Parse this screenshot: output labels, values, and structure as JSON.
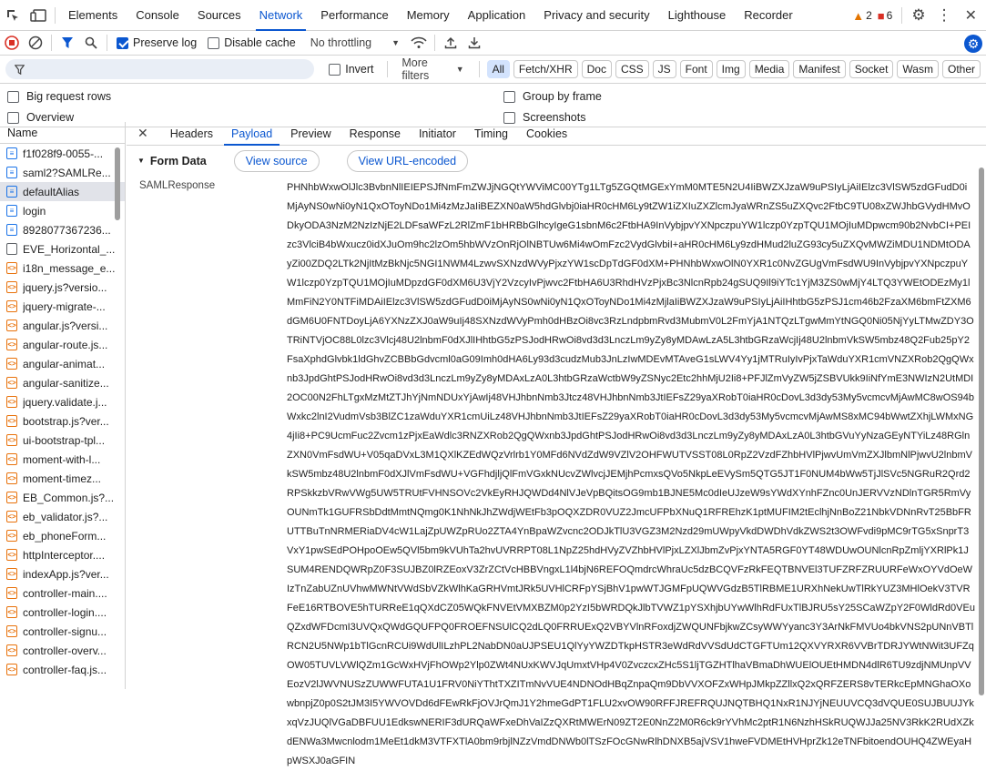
{
  "tabs": [
    "Elements",
    "Console",
    "Sources",
    "Network",
    "Performance",
    "Memory",
    "Application",
    "Privacy and security",
    "Lighthouse",
    "Recorder"
  ],
  "active_tab": "Network",
  "warnings_count": "2",
  "errors_count": "6",
  "toolbar": {
    "preserve_log": "Preserve log",
    "disable_cache": "Disable cache",
    "throttling": "No throttling"
  },
  "filter": {
    "invert": "Invert",
    "more_filters": "More filters",
    "chips": [
      "All",
      "Fetch/XHR",
      "Doc",
      "CSS",
      "JS",
      "Font",
      "Img",
      "Media",
      "Manifest",
      "Socket",
      "Wasm",
      "Other"
    ]
  },
  "options": {
    "big_request_rows": "Big request rows",
    "group_by_frame": "Group by frame",
    "overview": "Overview",
    "screenshots": "Screenshots"
  },
  "list_header": "Name",
  "requests": [
    {
      "name": "f1f028f9-0055-...",
      "type": "doc"
    },
    {
      "name": "saml2?SAMLRe...",
      "type": "doc"
    },
    {
      "name": "defaultAlias",
      "type": "doc",
      "selected": true
    },
    {
      "name": "login",
      "type": "doc"
    },
    {
      "name": "8928077367236...",
      "type": "doc"
    },
    {
      "name": "EVE_Horizontal_...",
      "type": "img"
    },
    {
      "name": "i18n_message_e...",
      "type": "js"
    },
    {
      "name": "jquery.js?versio...",
      "type": "js"
    },
    {
      "name": "jquery-migrate-...",
      "type": "js"
    },
    {
      "name": "angular.js?versi...",
      "type": "js"
    },
    {
      "name": "angular-route.js...",
      "type": "js"
    },
    {
      "name": "angular-animat...",
      "type": "js"
    },
    {
      "name": "angular-sanitize...",
      "type": "js"
    },
    {
      "name": "jquery.validate.j...",
      "type": "js"
    },
    {
      "name": "bootstrap.js?ver...",
      "type": "js"
    },
    {
      "name": "ui-bootstrap-tpl...",
      "type": "js"
    },
    {
      "name": "moment-with-l...",
      "type": "js"
    },
    {
      "name": "moment-timez...",
      "type": "js"
    },
    {
      "name": "EB_Common.js?...",
      "type": "js"
    },
    {
      "name": "eb_validator.js?...",
      "type": "js"
    },
    {
      "name": "eb_phoneForm...",
      "type": "js"
    },
    {
      "name": "httpInterceptor....",
      "type": "js"
    },
    {
      "name": "indexApp.js?ver...",
      "type": "js"
    },
    {
      "name": "controller-main....",
      "type": "js"
    },
    {
      "name": "controller-login....",
      "type": "js"
    },
    {
      "name": "controller-signu...",
      "type": "js"
    },
    {
      "name": "controller-overv...",
      "type": "js"
    },
    {
      "name": "controller-faq.js...",
      "type": "js"
    }
  ],
  "detail_tabs": [
    "Headers",
    "Payload",
    "Preview",
    "Response",
    "Initiator",
    "Timing",
    "Cookies"
  ],
  "active_detail_tab": "Payload",
  "form_data": {
    "title": "Form Data",
    "view_source": "View source",
    "view_url_encoded": "View URL-encoded",
    "key": "SAMLResponse",
    "value": "PHNhbWxwOlJlc3BvbnNlIEIEPSJfNmFmZWJjNGQtYWViMC00YTg1LTg5ZGQtMGExYmM0MTE5N2U4IiBWZXJzaW9uPSIyLjAiIElzc3VlSW5zdGFudD0iMjAyNS0wNi0yN1QxOToyNDo1Mi4zMzJaIiBEZXN0aW5hdGlvbj0iaHR0cHM6Ly9tZW1iZXIuZXZlcmJyaWRnZS5uZXQvc2FtbC9TU08xZWJhbGVydHMvODkyODA3NzM2NzIzNjE2LDFsaWFzL2RlZmF1bHRBbGlhcyIgeG1sbnM6c2FtbHA9InVybjpvYXNpczpuYW1lczp0YzpTQU1MOjIuMDpwcm90b2NvbCI+PEIzc3VlciB4bWxucz0idXJuOm9hc2lzOm5hbWVzOnRjOlNBTUw6Mi4wOmFzc2VydGlvbiI+aHR0cHM6Ly9zdHMud2luZG93cy5uZXQvMWZiMDU1NDMtODAyZi00ZDQ2LTk2NjItMzBkNjc5NGI1NWM4LzwvSXNzdWVyPjxzYW1scDpTdGF0dXM+PHNhbWxwOlN0YXR1c0NvZGUgVmFsdWU9InVybjpvYXNpczpuYW1lczp0YzpTQU1MOjIuMDpzdGF0dXM6U3VjY2VzcyIvPjwvc2FtbHA6U3RhdHVzPjxBc3NlcnRpb24gSUQ9Il9iYTc1YjM3ZS0wMjY4LTQ3YWEtODEzMy1lMmFiN2Y0NTFiMDAiIElzc3VlSW5zdGFudD0iMjAyNS0wNi0yN1QxOToyNDo1Mi4zMjlaIiBWZXJzaW9uPSIyLjAiIHhtbG5zPSJ1cm46b2FzaXM6bmFtZXM6dGM6U0FNTDoyLjA6YXNzZXJ0aW9uIj48SXNzdWVyPmh0dHBzOi8vc3RzLndpbmRvd3MubmV0L2FmYjA1NTQzLTgwMmYtNGQ0Ni05NjYyLTMwZDY3OTRiNTVjOC88L0lzc3Vlcj48U2lnbmF0dXJlIHhtbG5zPSJodHRwOi8vd3d3LnczLm9yZy8yMDAwLzA5L3htbGRzaWcjIj48U2lnbmVkSW5mbz48Q2Fub25pY2FsaXphdGlvbk1ldGhvZCBBbGdvcml0aG09Imh0dHA6Ly93d3cudzMub3JnLzIwMDEvMTAveG1sLWV4Yy1jMTRuIyIvPjxTaWduYXR1cmVNZXRob2QgQWxnb3JpdGhtPSJodHRwOi8vd3d3LnczLm9yZy8yMDAxLzA0L3htbGRzaWctbW9yZSNyc2Etc2hhMjU2Ii8+PFJlZmVyZW5jZSBVUkk9IiNfYmE3NWIzN2UtMDI2OC00N2FhLTgxMzMtZTJhYjNmNDUxYjAwIj48VHJhbnNmb3Jtcz48VHJhbnNmb3JtIEFsZ29yaXRobT0iaHR0cDovL3d3dy53My5vcmcvMjAwMC8wOS94bWxkc2lnI2VudmVsb3BlZC1zaWduYXR1cmUiLz48VHJhbnNmb3JtIEFsZ29yaXRobT0iaHR0cDovL3d3dy53My5vcmcvMjAwMS8xMC94bWwtZXhjLWMxNG4jIi8+PC9UcmFuc2Zvcm1zPjxEaWdlc3RNZXRob2QgQWxnb3JpdGhtPSJodHRwOi8vd3d3LnczLm9yZy8yMDAxLzA0L3htbGVuYyNzaGEyNTYiLz48RGlnZXN0VmFsdWU+V05qaDVxL3M1QXlKZEdWQzVrlrb1Y0MFd6NVdZdW9VZlV2OHFWUTVSST08L0RpZ2VzdFZhbHVlPjwvUmVmZXJlbmNlPjwvU2lnbmVkSW5mbz48U2lnbmF0dXJlVmFsdWU+VGFhdjljQlFmVGxkNUcvZWlvcjJEMjhPcmxsQVo5NkpLeEVySm5QTG5JT1F0NUM4bWw5TjJlSVc5NGRuR2Qrd2RPSkkzbVRwVWg5UW5TRUtFVHNSOVc2VkEyRHJQWDd4NlVJeVpBQitsOG9mb1BJNE5Mc0dIeUJzeW9sYWdXYnhFZnc0UnJERVVzNDlnTGR5RmVyOUNmTk1GUFRSbDdtMmtNQmg0K1NhNkJhZWdjWEtFb3pOQXZDR0VUZ2JmcUFPbXNuQ1RFREhzK1ptMUFIM2tEclhjNnBoZ21NbkVDNnRvT25BbFRUTTBuTnNRMERiaDV4cW1LajZpUWZpRUo2ZTA4YnBpaWZvcnc2ODJkTlU3VGZ3M2Nzd29mUWpyVkdDWDhVdkZWS2t3OWFvdi9pMC9rTG5xSnprT3VxY1pwSEdPOHpoOEw5QVl5bm9kVUhTa2hvUVRRPT08L1NpZ25hdHVyZVZhbHVlPjxLZXlJbmZvPjxYNTA5RGF0YT48WDUwOUNlcnRpZmljYXRlPk1JSUM4RENDQWRpZ0F3SUJBZ0lRZEoxV3ZrZCtVcHBBVngxL1l4bjN6REFOQmdrcWhraUc5dzBCQVFzRkFEQTBNVEl3TUFZRFZRUURFeWxOYVdOeWIzTnZabUZnUVhwMWNtVWdSbVZkWlhKaGRHVmtJRk5UVHlCRFpYSjBhV1pwWTJGMFpUQWVGdzB5TlRBME1URXhNekUwTlRkYUZ3MHlOekV3TVRFeE16RTBOVE5hTURReE1qQXdCZ05WQkFNVEtVMXBZM0p2YzI5bWRDQkJlbTVWZ1pYSXhjbUYwWlhRdFUxTlBJRU5sY25SCaWZpY2F0WldRd0VEuQZxdWFDcmI3UVQxQWdGQUFPQ0FROEFNSUlCQ2dLQ0FRRUExQ2VBYVlnRFoxdjZWQUNFbjkwZCsyWWYyanc3Y3ArNkFMVUo4bkVNS2pUNnVBTlRCN2U5NWp1bTlGcnRCUi9WdUlILzhPL2NabDN0aUJPSEU1QlYyYWZDTkpHSTR3eWdRdVVSdUdCTGFTUm12QXVYRXR6VVBrTDRJYWtNWit3UFZqOW05TUVLVWlQZm1GcWxHVjFhOWp2Ylp0ZWt4NUxKWVJqUmxtVHp4V0ZvczcxZHc5S1ljTGZHTlhaVBmaDhWUElOUEtHMDN4dlR6TU9zdjNMUnpVVEozV2lJWVNUSzZUWWFUTA1U1FRV0NiYThtTXZITmNvVUE4NDNOdHBqZnpaQm9DbVVXOFZxWHpJMkpZZllxQ2xQRFZERS8vTERkcEpMNGhaOXowbnpjZ0p0S2tJM3I5YWVOVDd6dFEwRkFjOVJrQmJ1Y2hmeGdPT1FLU2xvOW90RFFJREFRQUJNQTBHQ1NxR1NJYjNEUUVCQ3dVQUE0SUJBUUJYkxqVzJUQlVGaDBFUU1EdkswNERIF3dURQaWFxeDhVaIZzQXRtMWErN09ZT2E0NnZ2M0R6ck9rYVhMc2ptR1N6NzhHSkRUQWJJa25NV3RkK2RUdXZkdENWa3Mwcnlodm1MeEt1dkM3VTFXTlA0bm9rbjlNZzVmdDNWb0lTSzFOcGNwRlhDNXB5ajVSV1hweFVDMEtHVHprZk12eTNFbitoendOUHQ4ZWEyaHpWSXJ0aGFIN"
  }
}
